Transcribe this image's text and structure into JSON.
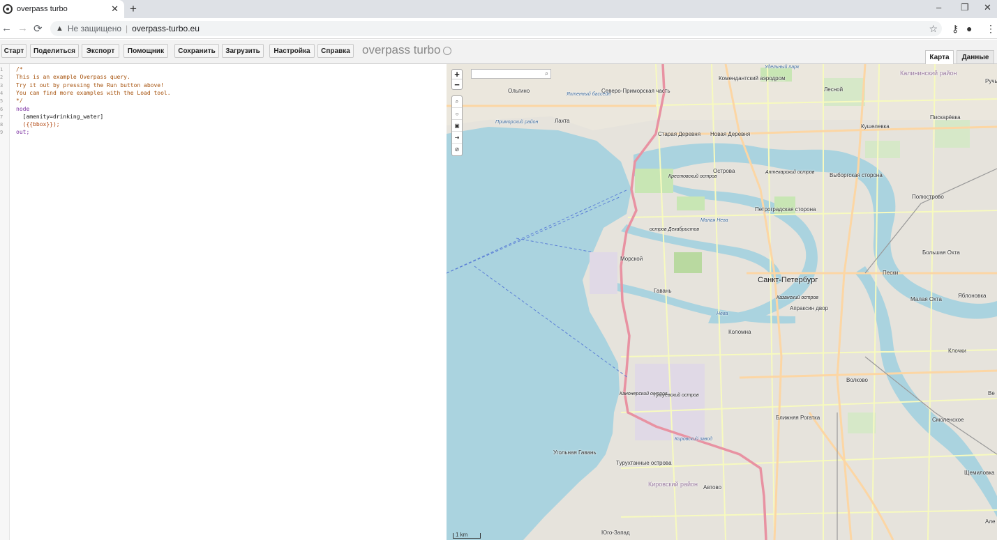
{
  "browser": {
    "tab_title": "overpass turbo",
    "new_tab": "+",
    "security_label": "Не защищено",
    "url": "overpass-turbo.eu",
    "minimize": "–",
    "maximize": "❐",
    "close": "✕"
  },
  "toolbar": {
    "buttons": [
      "Старт",
      "Поделиться",
      "Экспорт",
      "Помощник",
      "Сохранить",
      "Загрузить",
      "Настройка",
      "Справка"
    ],
    "brand": "overpass turbo"
  },
  "view_tabs": {
    "map": "Карта",
    "data": "Данные"
  },
  "editor": {
    "line_numbers": [
      "1",
      "2",
      "3",
      "4",
      "5",
      "6",
      "7",
      "8",
      "9"
    ],
    "lines": [
      {
        "cls": "c-comment",
        "text": "/*"
      },
      {
        "cls": "c-comment",
        "text": "This is an example Overpass query."
      },
      {
        "cls": "c-comment",
        "text": "Try it out by pressing the Run button above!"
      },
      {
        "cls": "c-comment",
        "text": "You can find more examples with the Load tool."
      },
      {
        "cls": "c-comment",
        "text": "*/"
      },
      {
        "cls": "c-kw",
        "text": "node"
      },
      {
        "cls": "c-plain",
        "text": "  [amenity=drinking_water]"
      },
      {
        "cls": "c-tmpl",
        "text": "  ({{bbox}});"
      },
      {
        "cls": "c-kw",
        "text": "out;"
      }
    ]
  },
  "map": {
    "zoom_in": "+",
    "zoom_out": "−",
    "scale_label": "1 km",
    "labels": {
      "sankt_peterburg": "Санкт-Петербург",
      "kalininsky": "Калининский район",
      "komendantsky": "Комендантский аэродром",
      "olgino": "Ольгино",
      "severo_primorskaya": "Северо-Приморская часть",
      "lesnoy": "Лесной",
      "lakhta": "Лахта",
      "yakhtenny": "Яхтенный бассейн",
      "primorsky": "Приморский район",
      "staraya_derevnya": "Старая Деревня",
      "novaya_derevnya": "Новая Деревня",
      "kushelevka": "Кушелевка",
      "piskarevka": "Пискарёвка",
      "ostrova": "Острова",
      "krestovsky": "Крестовский остров",
      "aptekarsky": "Аптекарский остров",
      "vyborgskaya": "Выборгская сторона",
      "polyustrovo": "Полюстрово",
      "petrogradskaya": "Петроградская сторона",
      "dekabristov": "остров Декабристов",
      "malaya_neva": "Малая Нева",
      "morskoy": "Морской",
      "gavan": "Гавань",
      "bolshaya_okhta": "Большая Охта",
      "peski": "Пески",
      "kazansky": "Казанский остров",
      "apraksin": "Апраксин двор",
      "malaya_okhta": "Малая Охта",
      "yablonovka": "Яблоновка",
      "neva": "Нева",
      "kolomna": "Коломна",
      "klochki": "Клочки",
      "volkovo": "Волково",
      "kanonersky": "Канонерский остров",
      "gutuevsky": "Гутуевский остров",
      "blizhnyaya_rogatka": "Ближняя Рогатка",
      "smolenskoe": "Смоленское",
      "kirovsky_zavod": "Кировский завод",
      "ugolnaya_gavan": "Угольная Гавань",
      "turukhtannye": "Турухтанные острова",
      "kirovsky_rayon": "Кировский район",
      "avtovo": "Автово",
      "yugo_zapad": "Юго-Запад",
      "shchemilovka": "Щемиловка",
      "rucheyi": "Ручьи",
      "udelny_park": "Удельный парк",
      "ale": "Але",
      "ve": "Ве"
    }
  },
  "colors": {
    "water": "#aad3df",
    "land": "#f2efe9",
    "park": "#c8e6b4",
    "motorway": "#e892a2",
    "primary_road": "#fcd6a4",
    "secondary_road": "#f7fabf"
  }
}
